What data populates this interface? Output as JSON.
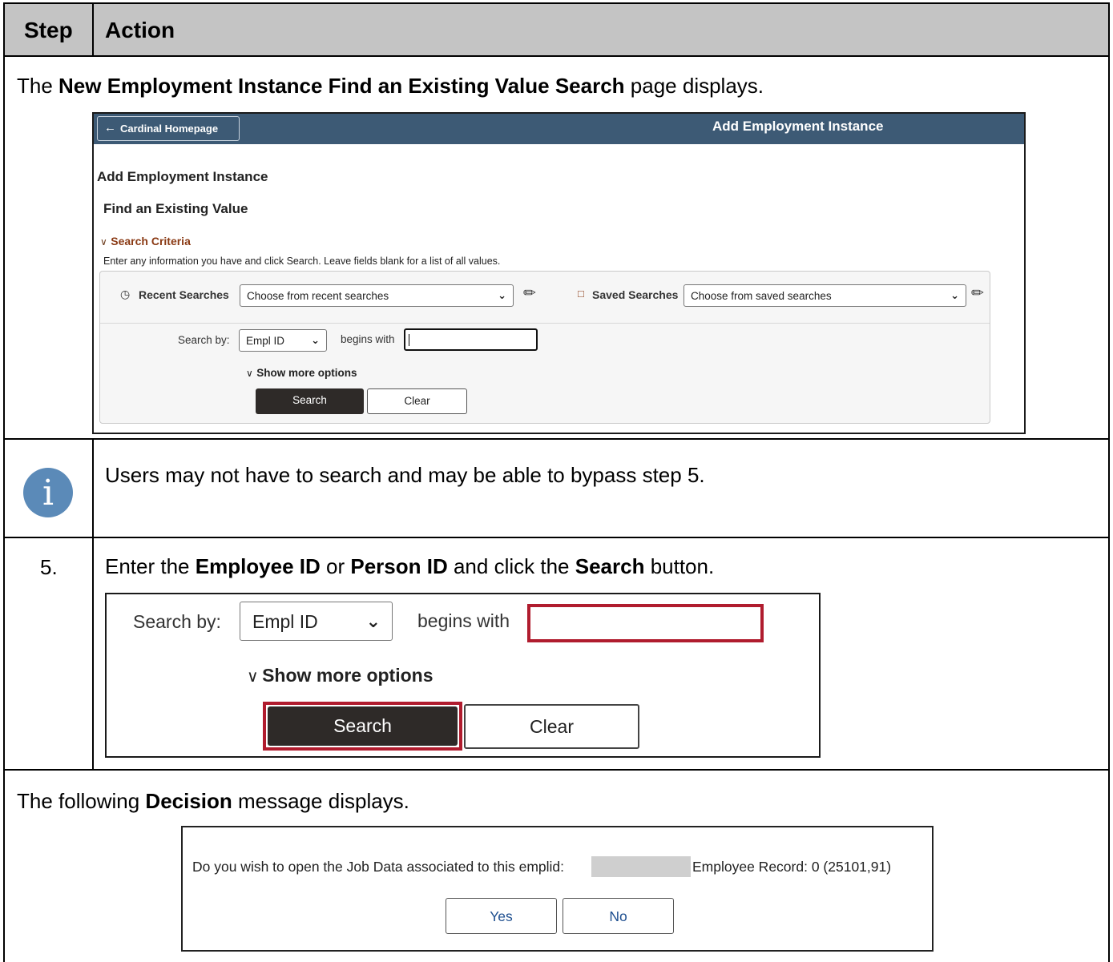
{
  "table": {
    "col_step": "Step",
    "col_action": "Action"
  },
  "intro": {
    "pre": "The ",
    "bold": "New Employment Instance Find an Existing Value Search",
    "post": " page displays."
  },
  "screen1": {
    "back_label": "Cardinal Homepage",
    "banner_title": "Add Employment Instance",
    "page_title": "Add Employment Instance",
    "section_title": "Find an Existing Value",
    "criteria_label": "Search Criteria",
    "instructions": "Enter any information you have and click Search. Leave fields blank for a list of all values.",
    "recent_label": "Recent Searches",
    "recent_value": "Choose from recent searches",
    "saved_label": "Saved Searches",
    "saved_value": "Choose from saved searches",
    "search_by_label": "Search by:",
    "search_by_value": "Empl ID",
    "operator": "begins with",
    "show_more": "Show more options",
    "search_button": "Search",
    "clear_button": "Clear",
    "banner_color": "#3d5a75"
  },
  "info_note": "Users may not have to search and may be able to bypass step 5.",
  "step5": {
    "number": "5.",
    "pre": "Enter the ",
    "b1": "Employee ID",
    "mid1": " or ",
    "b2": "Person ID",
    "mid2": " and click the ",
    "b3": "Search",
    "post": " button."
  },
  "screen2": {
    "search_by_label": "Search by:",
    "search_by_value": "Empl ID",
    "operator": "begins with",
    "show_more": "Show more options",
    "search_button": "Search",
    "clear_button": "Clear",
    "highlight_color": "#b01c2e"
  },
  "decision_intro": {
    "pre": "The following ",
    "bold": "Decision",
    "post": " message displays."
  },
  "dialog": {
    "question": "Do you wish to open the Job Data associated to this emplid:",
    "record": "Employee Record: 0 (25101,91)",
    "yes": "Yes",
    "no": "No"
  }
}
